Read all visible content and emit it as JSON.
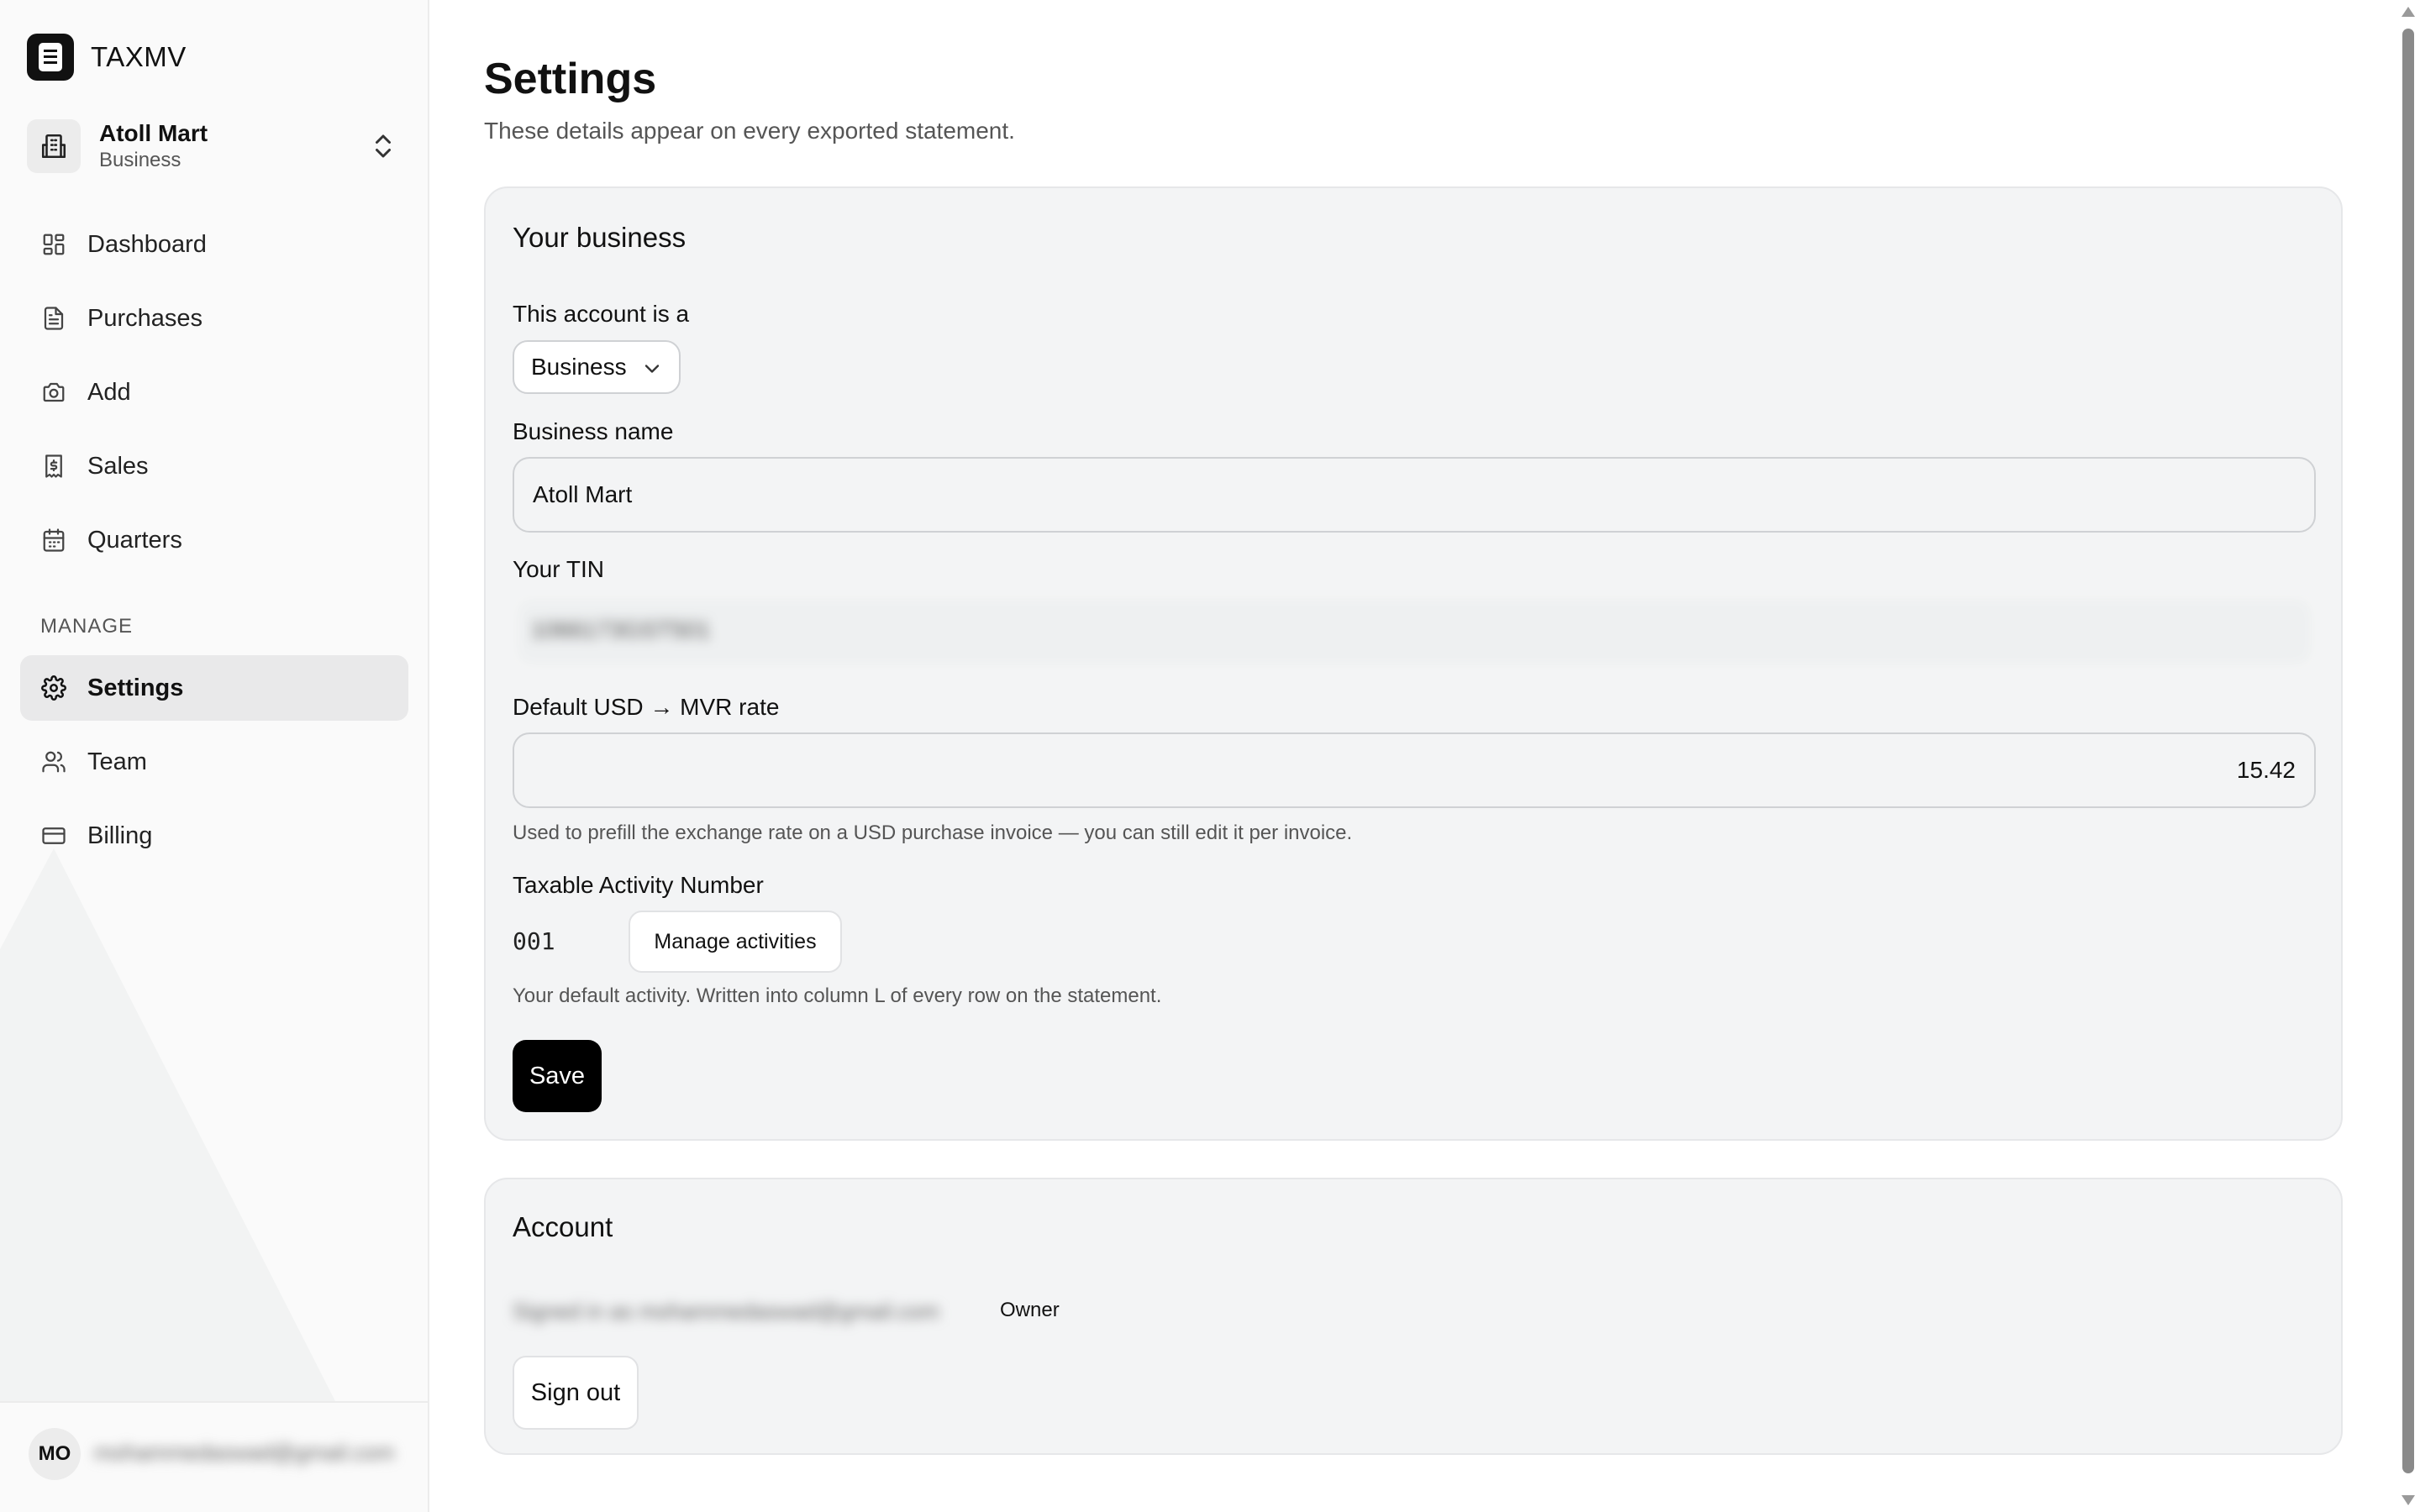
{
  "brand": {
    "name": "TAXMV"
  },
  "org": {
    "name": "Atoll Mart",
    "type": "Business"
  },
  "nav": {
    "items": [
      {
        "label": "Dashboard"
      },
      {
        "label": "Purchases"
      },
      {
        "label": "Add"
      },
      {
        "label": "Sales"
      },
      {
        "label": "Quarters"
      }
    ],
    "manage_label": "MANAGE",
    "manage_items": [
      {
        "label": "Settings",
        "active": true
      },
      {
        "label": "Team"
      },
      {
        "label": "Billing"
      }
    ]
  },
  "user": {
    "initials": "MO",
    "email": "mohammedaswad@gmail.com"
  },
  "page": {
    "title": "Settings",
    "subtitle": "These details appear on every exported statement."
  },
  "business_card": {
    "title": "Your business",
    "account_type_label": "This account is a",
    "account_type_value": "Business",
    "business_name_label": "Business name",
    "business_name_value": "Atoll Mart",
    "tin_label": "Your TIN",
    "tin_value": "1066173GST501",
    "rate_label": "Default USD → MVR rate",
    "rate_value": "15.42",
    "rate_help": "Used to prefill the exchange rate on a USD purchase invoice — you can still edit it per invoice.",
    "activity_label": "Taxable Activity Number",
    "activity_code": "001",
    "manage_activities_label": "Manage activities",
    "activity_help": "Your default activity. Written into column L of every row on the statement.",
    "save_label": "Save"
  },
  "account_card": {
    "title": "Account",
    "signed_in_text": "Signed in as mohammedaswad@gmail.com",
    "role": "Owner",
    "sign_out_label": "Sign out"
  },
  "colors": {
    "accent": "#000000",
    "card_bg": "#f3f4f5",
    "active_nav_bg": "#e9e9ea"
  }
}
